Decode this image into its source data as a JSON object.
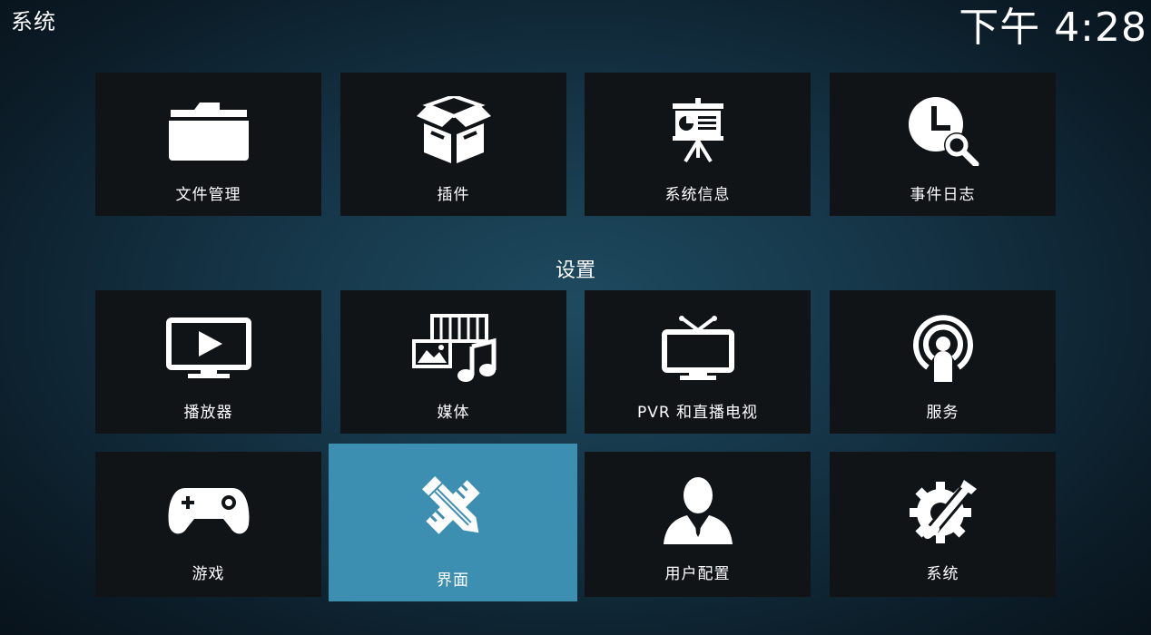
{
  "header": {
    "title": "系统",
    "clock": "下午 4:28"
  },
  "top_tiles": [
    {
      "label": "文件管理",
      "icon": "folder-icon"
    },
    {
      "label": "插件",
      "icon": "box-icon"
    },
    {
      "label": "系统信息",
      "icon": "presentation-icon"
    },
    {
      "label": "事件日志",
      "icon": "clock-search-icon"
    }
  ],
  "settings": {
    "heading": "设置",
    "tiles": [
      {
        "label": "播放器",
        "icon": "monitor-play-icon"
      },
      {
        "label": "媒体",
        "icon": "media-icon"
      },
      {
        "label": "PVR 和直播电视",
        "icon": "tv-icon"
      },
      {
        "label": "服务",
        "icon": "broadcast-icon"
      },
      {
        "label": "游戏",
        "icon": "gamepad-icon"
      },
      {
        "label": "界面",
        "icon": "pencil-ruler-icon",
        "focused": true
      },
      {
        "label": "用户配置",
        "icon": "user-icon"
      },
      {
        "label": "系统",
        "icon": "gear-wrench-icon"
      }
    ]
  },
  "colors": {
    "tile_bg": "#101417",
    "focus_bg": "#3d8fb2",
    "text": "#ffffff"
  }
}
